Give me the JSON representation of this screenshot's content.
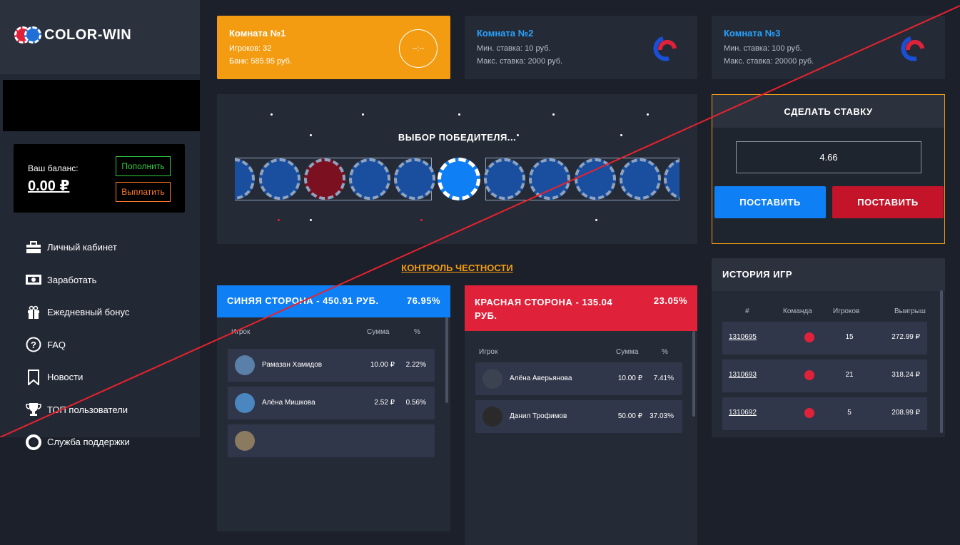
{
  "brand": {
    "logo_text": "COLOR-WIN"
  },
  "balance": {
    "label": "Ваш баланс:",
    "value": "0.00 ₽",
    "topup_label": "Пополнить",
    "withdraw_label": "Выплатить"
  },
  "nav": [
    {
      "label": "Личный кабинет",
      "icon": "briefcase-icon"
    },
    {
      "label": "Заработать",
      "icon": "money-icon"
    },
    {
      "label": "Ежедневный бонус",
      "icon": "gift-icon"
    },
    {
      "label": "FAQ",
      "icon": "question-icon"
    },
    {
      "label": "Новости",
      "icon": "bookmark-icon"
    },
    {
      "label": "ТОП пользователи",
      "icon": "trophy-icon"
    },
    {
      "label": "Служба поддержки",
      "icon": "lifebuoy-icon"
    }
  ],
  "rooms": [
    {
      "title": "Комната №1",
      "line1": "Игроков: 32",
      "line2": "Банк: 585.95 руб.",
      "timer": "--:--"
    },
    {
      "title": "Комната №2",
      "line1": "Мин. ставка: 10 руб.",
      "line2": "Макс. ставка: 2000 руб."
    },
    {
      "title": "Комната №3",
      "line1": "Мин. ставка: 100 руб.",
      "line2": "Макс. ставка: 20000 руб."
    }
  ],
  "game": {
    "status": "ВЫБОР ПОБЕДИТЕЛЯ..."
  },
  "honesty": {
    "label": "КОНТРОЛЬ ЧЕСТНОСТИ"
  },
  "blue_side": {
    "title": "СИНЯЯ СТОРОНА - 450.91 РУБ.",
    "percent": "76.95%",
    "col_player": "Игрок",
    "col_sum": "Сумма",
    "col_pct": "%",
    "rows": [
      {
        "name": "Рамазан Хамидов",
        "sum": "10.00 ₽",
        "pct": "2.22%"
      },
      {
        "name": "Алёна Мишкова",
        "sum": "2.52 ₽",
        "pct": "0.56%"
      }
    ]
  },
  "red_side": {
    "title": "КРАСНАЯ СТОРОНА - 135.04 РУБ.",
    "percent": "23.05%",
    "col_player": "Игрок",
    "col_sum": "Сумма",
    "col_pct": "%",
    "rows": [
      {
        "name": "Алёна Аверьянова",
        "sum": "10.00 ₽",
        "pct": "7.41%"
      },
      {
        "name": "Данил Трофимов",
        "sum": "50.00 ₽",
        "pct": "37.03%"
      }
    ]
  },
  "bet": {
    "title": "СДЕЛАТЬ СТАВКУ",
    "amount": "4.66",
    "blue_label": "ПОСТАВИТЬ",
    "red_label": "ПОСТАВИТЬ"
  },
  "history": {
    "title": "ИСТОРИЯ ИГР",
    "col_id": "#",
    "col_team": "Команда",
    "col_players": "Игроков",
    "col_win": "Выигрыш",
    "rows": [
      {
        "id": "1310695",
        "team_color": "#e0213a",
        "players": "15",
        "win": "272.99 ₽"
      },
      {
        "id": "1310693",
        "team_color": "#e0213a",
        "players": "21",
        "win": "318.24 ₽"
      },
      {
        "id": "1310692",
        "team_color": "#e0213a",
        "players": "5",
        "win": "208.99 ₽"
      }
    ]
  },
  "colors": {
    "accent": "#f39c12",
    "blue": "#0f7ff5",
    "red": "#e0213a",
    "green": "#2ecc40",
    "orange": "#ff7a2a"
  }
}
